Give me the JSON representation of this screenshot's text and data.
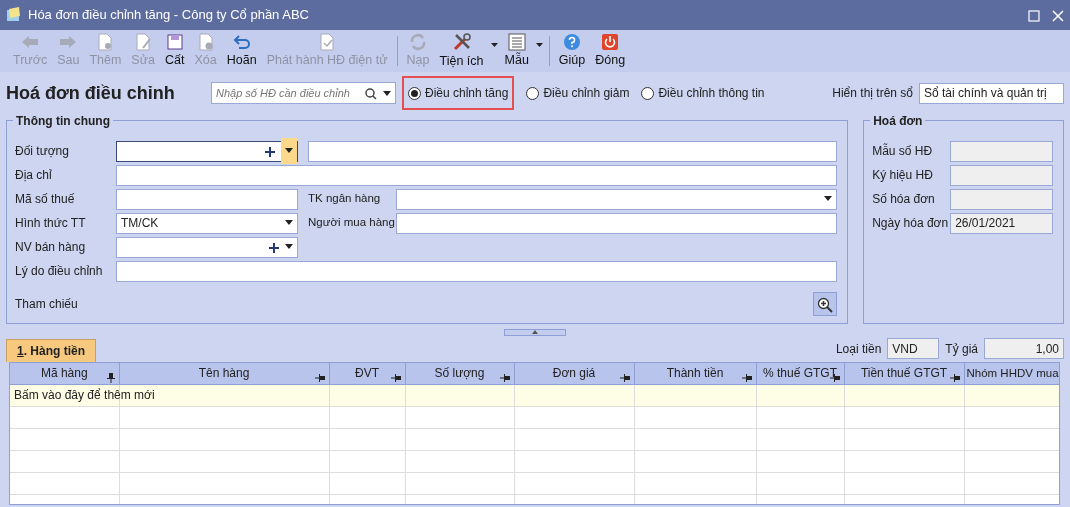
{
  "window": {
    "title": "Hóa đơn điều chỉnh tăng - Công ty Cổ phần ABC"
  },
  "toolbar": {
    "groups": [
      [
        {
          "label": "Trước",
          "disabled": true,
          "dropdown": false
        },
        {
          "label": "Sau",
          "disabled": true,
          "dropdown": false
        },
        {
          "label": "Thêm",
          "disabled": true,
          "dropdown": false
        },
        {
          "label": "Sửa",
          "disabled": true,
          "dropdown": false
        },
        {
          "label": "Cất",
          "disabled": false,
          "dropdown": false
        },
        {
          "label": "Xóa",
          "disabled": true,
          "dropdown": false
        },
        {
          "label": "Hoãn",
          "disabled": false,
          "dropdown": false
        },
        {
          "label": "Phát hành HĐ điện tử",
          "disabled": true,
          "dropdown": false
        }
      ],
      [
        {
          "label": "Nạp",
          "disabled": true,
          "dropdown": false
        },
        {
          "label": "Tiện ích",
          "disabled": false,
          "dropdown": true
        },
        {
          "label": "Mẫu",
          "disabled": false,
          "dropdown": true
        }
      ],
      [
        {
          "label": "Giúp",
          "disabled": false,
          "dropdown": false
        },
        {
          "label": "Đóng",
          "disabled": false,
          "dropdown": false
        }
      ]
    ]
  },
  "header": {
    "title": "Hoá đơn điều chỉnh",
    "search": {
      "placeholder": "Nhập số HĐ cần điều chỉnh"
    },
    "radios": [
      {
        "label": "Điều chỉnh tăng",
        "selected": true,
        "highlighted": true
      },
      {
        "label": "Điều chỉnh giảm",
        "selected": false,
        "highlighted": false
      },
      {
        "label": "Điều chỉnh thông tin",
        "selected": false,
        "highlighted": false
      }
    ],
    "display_label": "Hiển thị trên sổ",
    "display_value": "Sổ tài chính và quản trị"
  },
  "general_info": {
    "title": "Thông tin chung",
    "rows": [
      [
        {
          "label": "Đối tượng",
          "kind": "combo_add",
          "focused": true
        },
        {
          "kind": "text",
          "focused": false
        }
      ],
      [
        {
          "label": "Địa chỉ",
          "kind": "text",
          "focused": false
        }
      ],
      [
        {
          "label": "Mã số thuế",
          "kind": "text",
          "focused": false
        },
        {
          "label": "TK ngân hàng",
          "kind": "combo",
          "focused": false
        }
      ],
      [
        {
          "label": "Hình thức TT",
          "kind": "combo",
          "value": "TM/CK",
          "focused": false
        },
        {
          "label": "Người mua hàng",
          "kind": "text",
          "focused": false
        }
      ],
      [
        {
          "label": "NV bán hàng",
          "kind": "combo_add",
          "focused": false
        }
      ],
      [
        {
          "label": "Lý do điều chỉnh",
          "kind": "text",
          "focused": false
        }
      ],
      [
        {
          "label": "Tham chiếu",
          "kind": "lookup"
        }
      ]
    ]
  },
  "invoice": {
    "title": "Hoá đơn",
    "fields": [
      {
        "label": "Mẫu số HĐ"
      },
      {
        "label": "Ký hiệu HĐ"
      },
      {
        "label": "Số hóa đơn"
      },
      {
        "label": "Ngày hóa đơn",
        "value": "26/01/2021"
      }
    ]
  },
  "tabs": [
    {
      "label": "1. Hàng tiền",
      "selected": true
    }
  ],
  "currency": {
    "label": "Loại tiền",
    "value": "VND",
    "rate_label": "Tỷ giá",
    "rate_value": "1,00"
  },
  "table": {
    "columns": [
      {
        "label": "Mã hàng",
        "pinned": true
      },
      {
        "label": "Tên hàng",
        "pinned": false
      },
      {
        "label": "ĐVT",
        "pinned": false
      },
      {
        "label": "Số lượng",
        "pinned": false
      },
      {
        "label": "Đơn giá",
        "pinned": false
      },
      {
        "label": "Thành tiền",
        "pinned": false
      },
      {
        "label": "% thuế GTGT",
        "pinned": false
      },
      {
        "label": "Tiền thuế GTGT",
        "pinned": false
      },
      {
        "label": "Nhóm HHDV mua"
      }
    ],
    "new_row_hint": "Bấm vào đây để thêm mới"
  }
}
